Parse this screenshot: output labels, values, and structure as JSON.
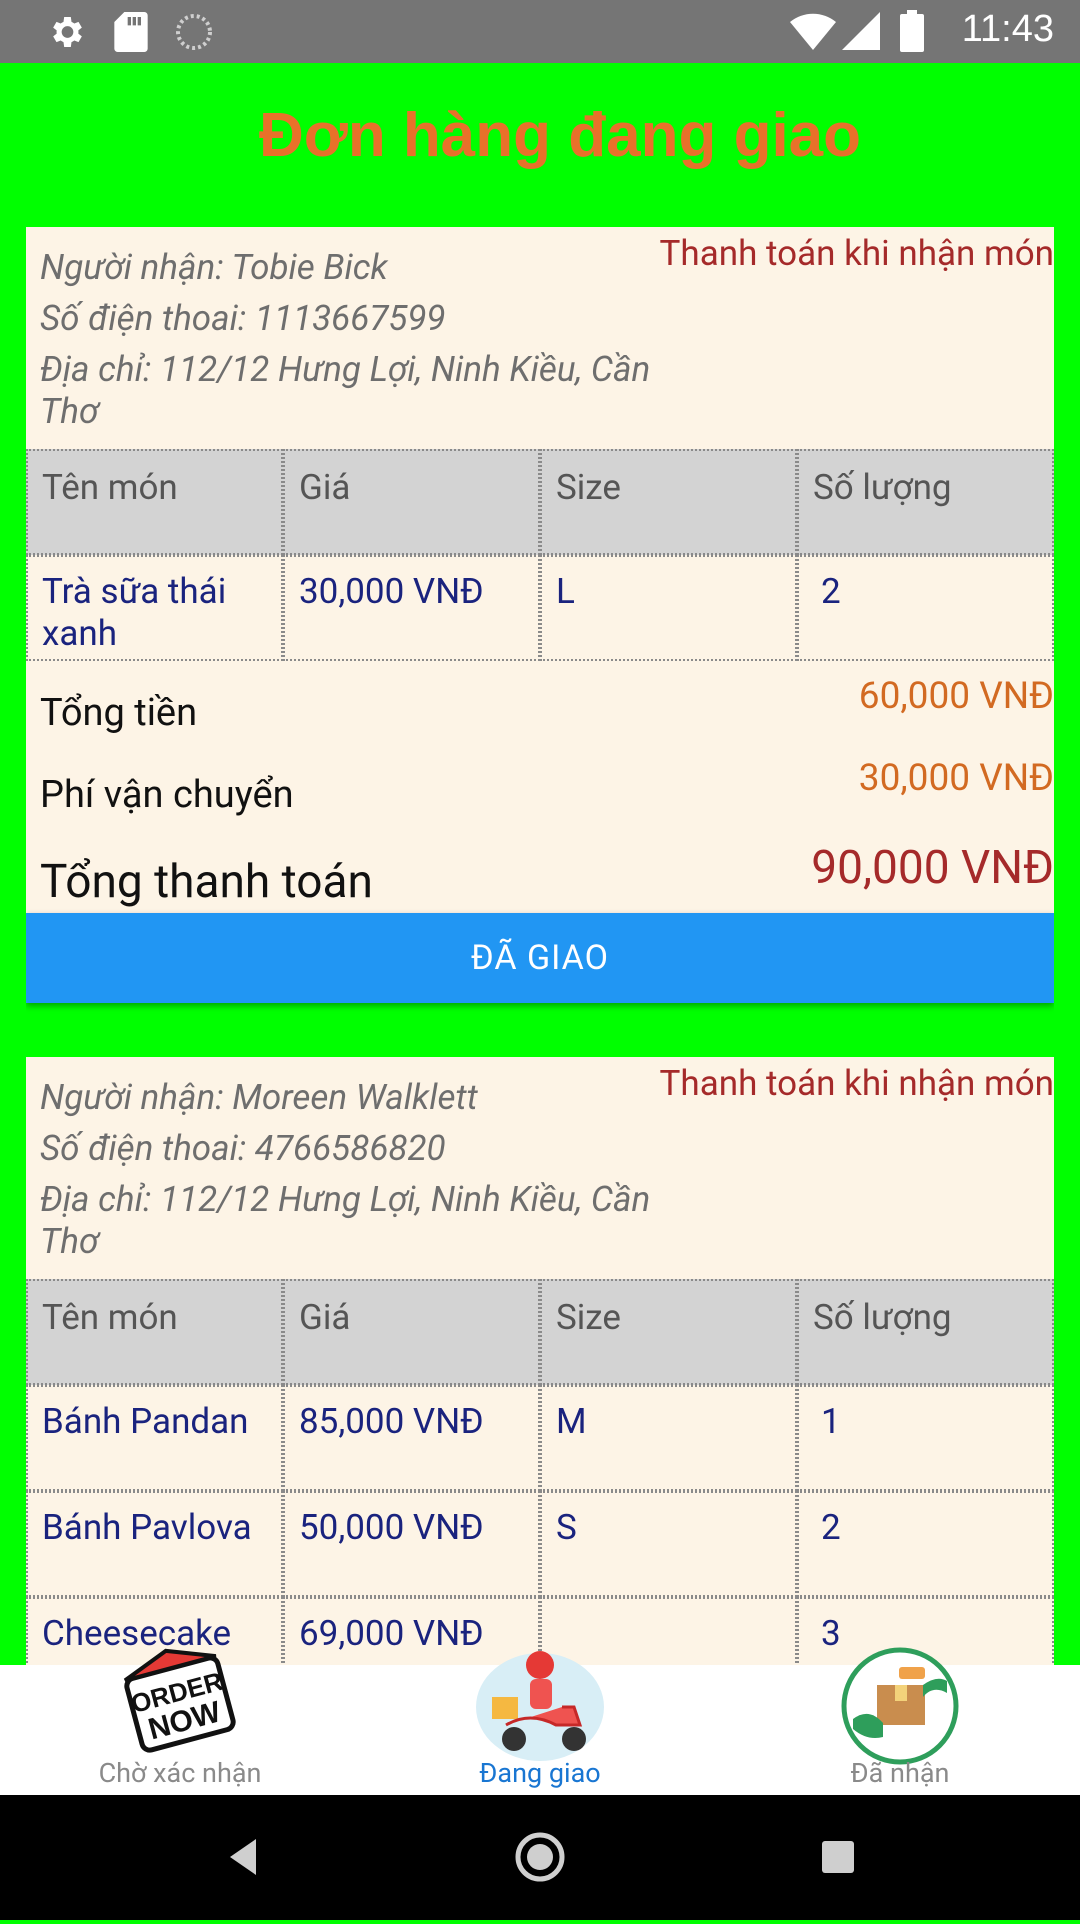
{
  "status_bar": {
    "time": "11:43"
  },
  "page": {
    "title": "Đơn hàng đang giao"
  },
  "orders": [
    {
      "recipient": "Người nhận: Tobie Bick",
      "phone": "Số điện thoai: 1113667599",
      "address": "Địa chỉ: 112/12 Hưng Lợi, Ninh Kiều, Cần Thơ",
      "payment_method": "Thanh toán khi nhận món",
      "table_headers": [
        "Tên món",
        "Giá",
        "Size",
        "Số lượng"
      ],
      "items": [
        {
          "name": "Trà sữa thái xanh",
          "price": "30,000 VNĐ",
          "size": "L",
          "qty": "2"
        }
      ],
      "subtotal_label": "Tổng tiền",
      "subtotal": "60,000 VNĐ",
      "shipping_label": "Phí vận chuyển",
      "shipping": "30,000 VNĐ",
      "total_label": "Tổng thanh toán",
      "total": "90,000 VNĐ",
      "action_label": "ĐÃ GIAO"
    },
    {
      "recipient": "Người nhận: Moreen Walklett",
      "phone": "Số điện thoai: 4766586820",
      "address": "Địa chỉ: 112/12 Hưng Lợi, Ninh Kiều, Cần Thơ",
      "payment_method": "Thanh toán khi nhận món",
      "table_headers": [
        "Tên món",
        "Giá",
        "Size",
        "Số lượng"
      ],
      "items": [
        {
          "name": "Bánh Pandan",
          "price": "85,000 VNĐ",
          "size": "M",
          "qty": "1"
        },
        {
          "name": "Bánh Pavlova",
          "price": "50,000 VNĐ",
          "size": "S",
          "qty": "2"
        },
        {
          "name": "Cheesecake",
          "price": "69,000 VNĐ",
          "size": "",
          "qty": "3"
        }
      ]
    }
  ],
  "bottom_nav": {
    "items": [
      {
        "label": "Chờ xác nhận",
        "icon": "order-now-icon",
        "logo_text": "ORDER NOW"
      },
      {
        "label": "Đang giao",
        "icon": "delivery-scooter-icon"
      },
      {
        "label": "Đã nhận",
        "icon": "package-received-icon"
      }
    ],
    "active_color": "#1976d2"
  },
  "colors": {
    "background": "#00ff00",
    "title": "#e8712a",
    "button": "#2196f3",
    "card": "#fdf4e6"
  }
}
